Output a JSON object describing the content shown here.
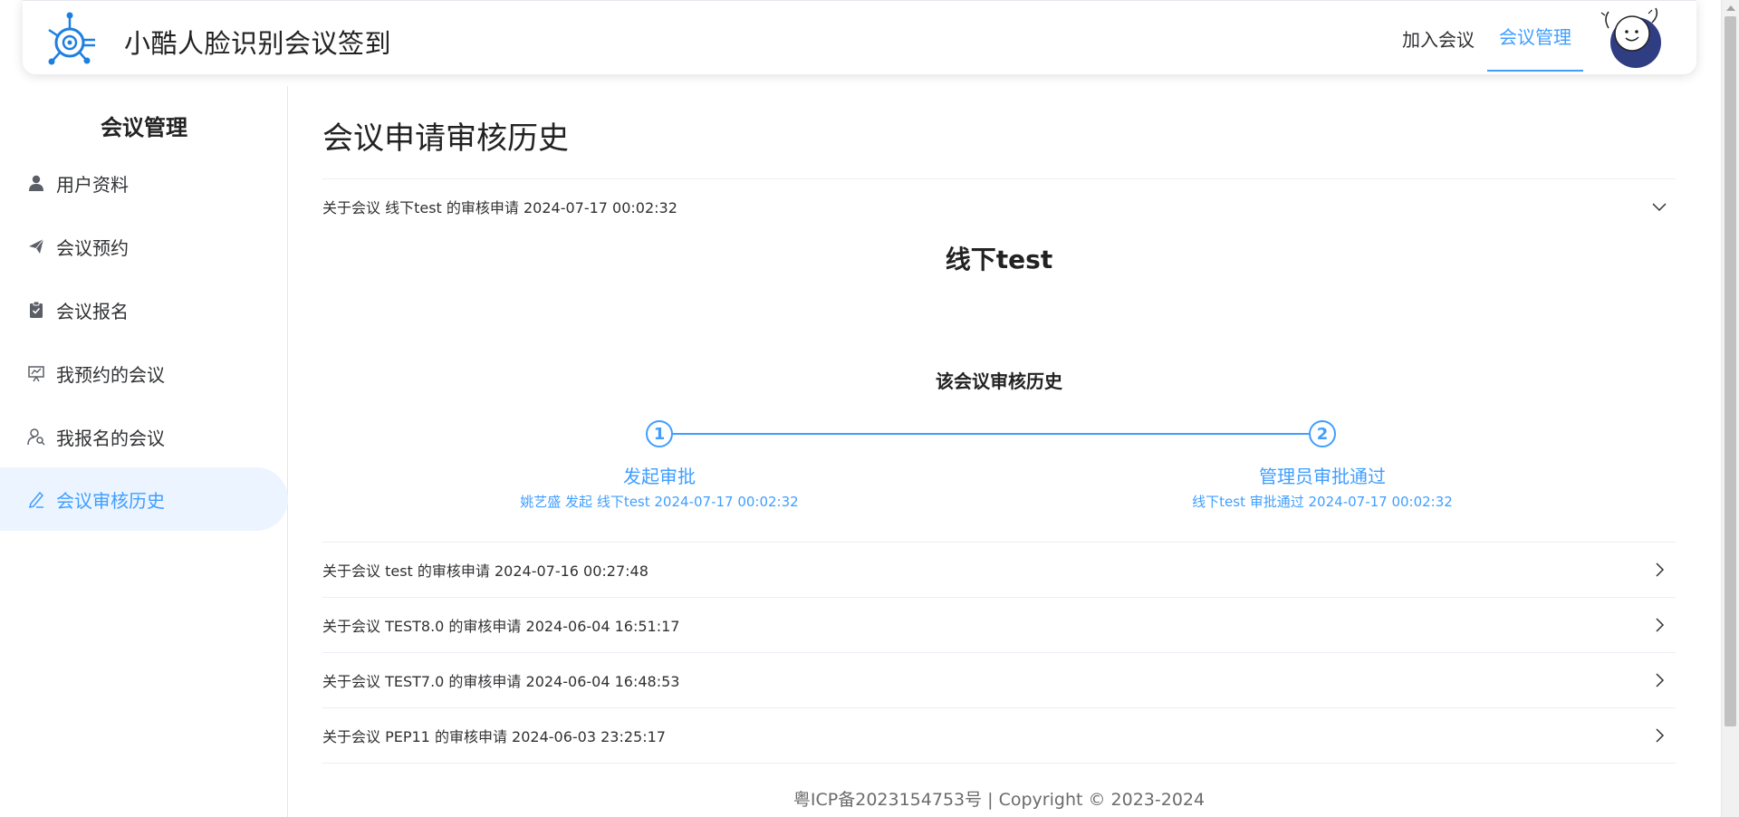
{
  "app": {
    "title": "小酷人脸识别会议签到"
  },
  "nav": {
    "join": "加入会议",
    "manage": "会议管理"
  },
  "sidebar": {
    "title": "会议管理",
    "items": [
      {
        "label": "用户资料",
        "icon": "user-icon"
      },
      {
        "label": "会议预约",
        "icon": "send-icon"
      },
      {
        "label": "会议报名",
        "icon": "clipboard-icon"
      },
      {
        "label": "我预约的会议",
        "icon": "presentation-icon"
      },
      {
        "label": "我报名的会议",
        "icon": "user-search-icon"
      },
      {
        "label": "会议审核历史",
        "icon": "edit-pen-icon",
        "active": true
      }
    ]
  },
  "main": {
    "title": "会议申请审核历史",
    "expanded": {
      "header": "关于会议 线下test 的审核申请 2024-07-17 00:02:32",
      "meeting_name": "线下test",
      "history_title": "该会议审核历史",
      "steps": [
        {
          "number": "1",
          "title": "发起审批",
          "desc": "姚艺盛 发起 线下test 2024-07-17 00:02:32"
        },
        {
          "number": "2",
          "title": "管理员审批通过",
          "desc": "线下test 审批通过 2024-07-17 00:02:32"
        }
      ]
    },
    "collapsed": [
      "关于会议 test 的审核申请 2024-07-16 00:27:48",
      "关于会议 TEST8.0 的审核申请 2024-06-04 16:51:17",
      "关于会议 TEST7.0 的审核申请 2024-06-04 16:48:53",
      "关于会议 PEP11 的审核申请 2024-06-03 23:25:17"
    ]
  },
  "footer": {
    "text": "粤ICP备2023154753号 |   Copyright © 2023-2024"
  },
  "colors": {
    "accent": "#409eff",
    "active_bg": "#ecf5ff"
  }
}
